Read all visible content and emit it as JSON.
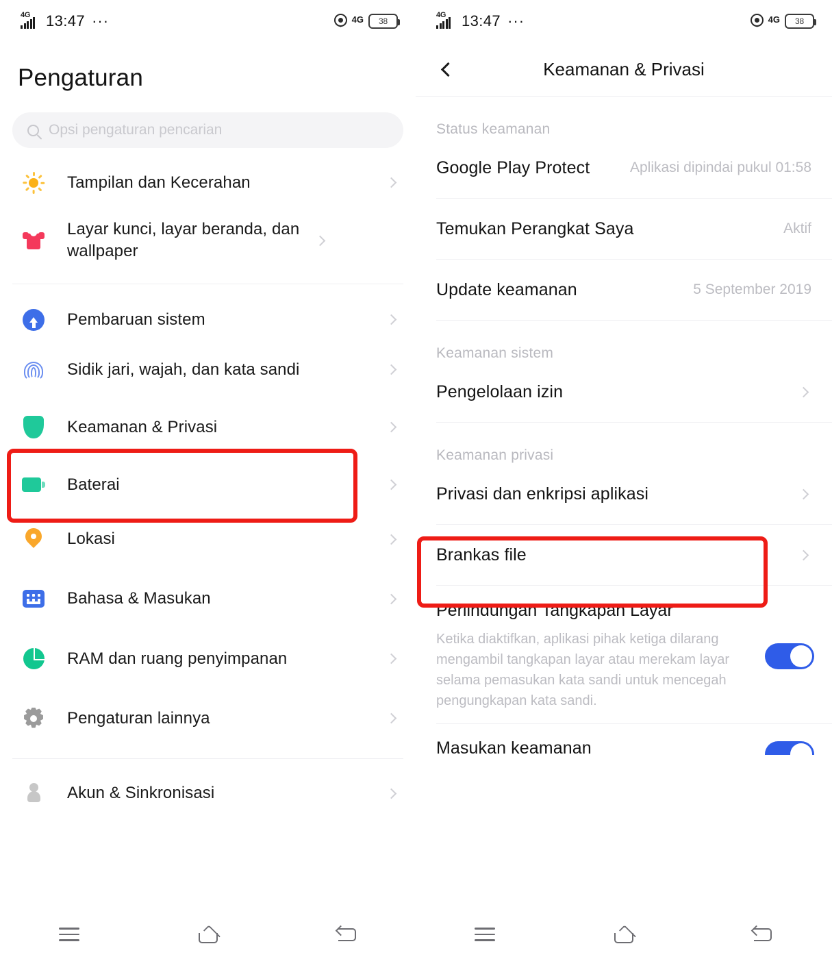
{
  "statusbar": {
    "network_label": "4G",
    "time": "13:47",
    "more_dots": "···",
    "location_icon": "location-pin-icon",
    "right_network_label": "4G",
    "battery_level": "38"
  },
  "left": {
    "title": "Pengaturan",
    "search": {
      "placeholder": "Opsi pengaturan pencarian",
      "icon": "search-icon",
      "value": ""
    },
    "groups": [
      {
        "items": [
          {
            "label": "Tampilan dan Kecerahan",
            "icon": "sun-icon"
          },
          {
            "label": "Layar kunci, layar beranda, dan wallpaper",
            "icon": "tshirt-icon"
          }
        ]
      },
      {
        "items": [
          {
            "label": "Pembaruan sistem",
            "icon": "system-update-icon"
          },
          {
            "label": "Sidik jari, wajah, dan kata sandi",
            "icon": "fingerprint-icon"
          },
          {
            "label": "Keamanan & Privasi",
            "icon": "shield-icon",
            "highlighted": true
          },
          {
            "label": "Baterai",
            "icon": "battery-icon"
          },
          {
            "label": "Lokasi",
            "icon": "location-pin-icon"
          },
          {
            "label": "Bahasa & Masukan",
            "icon": "keyboard-icon"
          },
          {
            "label": "RAM dan ruang penyimpanan",
            "icon": "pie-chart-icon"
          },
          {
            "label": "Pengaturan lainnya",
            "icon": "gear-icon"
          }
        ]
      },
      {
        "items": [
          {
            "label": "Akun & Sinkronisasi",
            "icon": "account-icon"
          }
        ]
      }
    ]
  },
  "right": {
    "header": {
      "title": "Keamanan & Privasi",
      "back_icon": "back-chevron-icon"
    },
    "sections": [
      {
        "header": "Status keamanan",
        "rows": [
          {
            "title": "Google Play Protect",
            "value": "Aplikasi dipindai pukul 01:58"
          },
          {
            "title": "Temukan Perangkat Saya",
            "value": "Aktif"
          },
          {
            "title": "Update keamanan",
            "value": "5 September 2019"
          }
        ]
      },
      {
        "header": "Keamanan sistem",
        "rows": [
          {
            "title": "Pengelolaan izin",
            "chevron": true
          }
        ]
      },
      {
        "header": "Keamanan privasi",
        "rows": [
          {
            "title": "Privasi dan enkripsi aplikasi",
            "chevron": true,
            "highlighted": true
          },
          {
            "title": "Brankas file",
            "chevron": true
          },
          {
            "title": "Perlindungan Tangkapan Layar",
            "description": "Ketika diaktifkan, aplikasi pihak ketiga dilarang mengambil tangkapan layar atau merekam layar selama pemasukan kata sandi untuk mencegah pengungkapan kata sandi.",
            "toggle": "on"
          },
          {
            "title": "Masukan keamanan",
            "toggle": "on"
          }
        ]
      }
    ]
  },
  "navbar": {
    "recents_label": "recents-icon",
    "home_label": "home-icon",
    "back_label": "back-icon"
  },
  "annotations": {
    "accent_color": "#ee1c16",
    "left_highlight_label": "Keamanan & Privasi",
    "right_highlight_label": "Privasi dan enkripsi aplikasi"
  }
}
